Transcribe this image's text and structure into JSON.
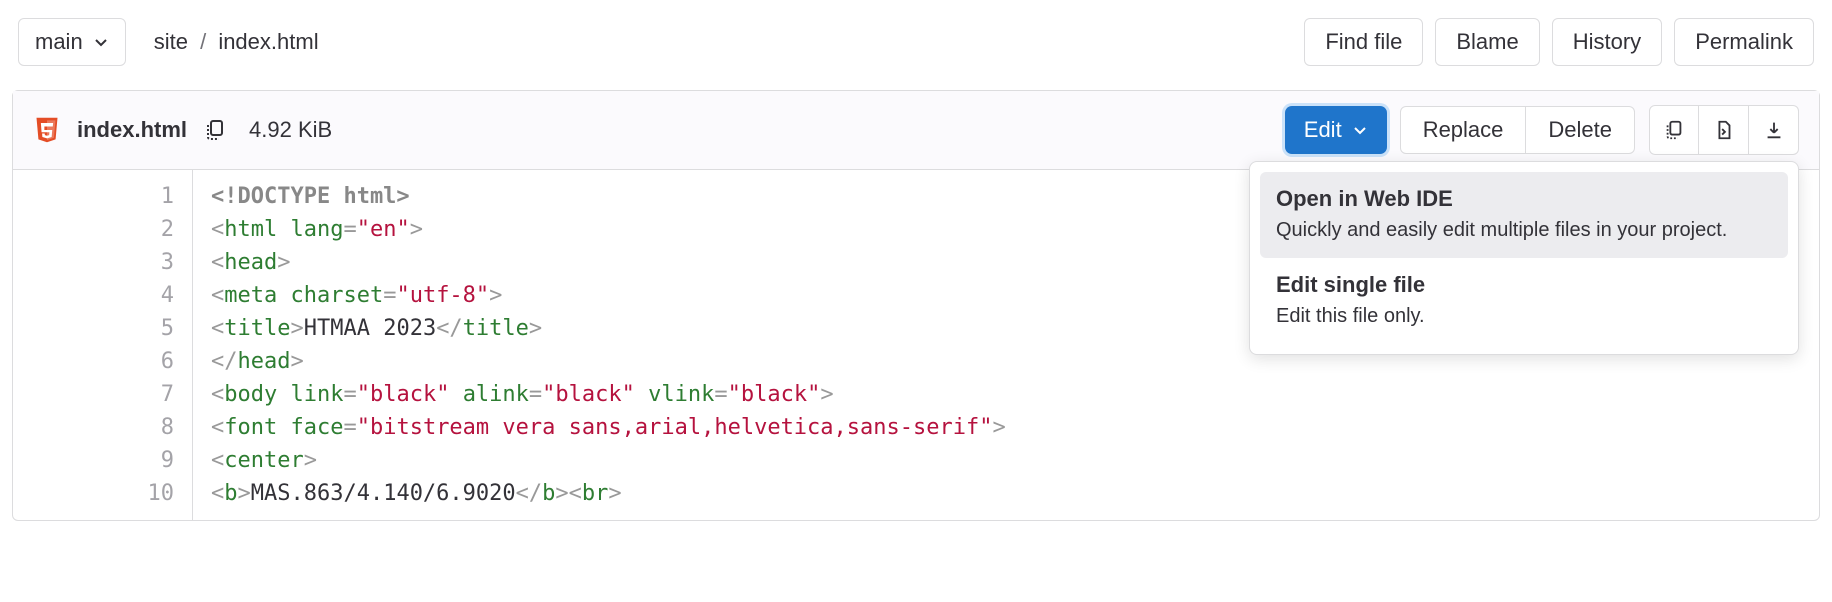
{
  "branch": {
    "label": "main"
  },
  "breadcrumb": {
    "dir": "site",
    "sep": "/",
    "file": "index.html"
  },
  "top_actions": {
    "find": "Find file",
    "blame": "Blame",
    "history": "History",
    "permalink": "Permalink"
  },
  "file": {
    "name": "index.html",
    "size": "4.92 KiB"
  },
  "header_actions": {
    "edit": "Edit",
    "replace": "Replace",
    "delete": "Delete"
  },
  "dropdown": {
    "items": [
      {
        "title": "Open in Web IDE",
        "desc": "Quickly and easily edit multiple files in your project.",
        "active": true
      },
      {
        "title": "Edit single file",
        "desc": "Edit this file only.",
        "active": false
      }
    ]
  },
  "code": {
    "lines": [
      {
        "n": 1,
        "tokens": [
          [
            "d",
            "<!DOCTYPE html>"
          ]
        ]
      },
      {
        "n": 2,
        "tokens": [
          [
            "p",
            "<"
          ],
          [
            "t",
            "html"
          ],
          [
            "tx",
            " "
          ],
          [
            "a",
            "lang"
          ],
          [
            "p",
            "="
          ],
          [
            "s",
            "\"en\""
          ],
          [
            "p",
            ">"
          ]
        ]
      },
      {
        "n": 3,
        "tokens": [
          [
            "p",
            "<"
          ],
          [
            "t",
            "head"
          ],
          [
            "p",
            ">"
          ]
        ]
      },
      {
        "n": 4,
        "tokens": [
          [
            "p",
            "<"
          ],
          [
            "t",
            "meta"
          ],
          [
            "tx",
            " "
          ],
          [
            "a",
            "charset"
          ],
          [
            "p",
            "="
          ],
          [
            "s",
            "\"utf-8\""
          ],
          [
            "p",
            ">"
          ]
        ]
      },
      {
        "n": 5,
        "tokens": [
          [
            "p",
            "<"
          ],
          [
            "t",
            "title"
          ],
          [
            "p",
            ">"
          ],
          [
            "tx",
            "HTMAA 2023"
          ],
          [
            "p",
            "</"
          ],
          [
            "t",
            "title"
          ],
          [
            "p",
            ">"
          ]
        ]
      },
      {
        "n": 6,
        "tokens": [
          [
            "p",
            "</"
          ],
          [
            "t",
            "head"
          ],
          [
            "p",
            ">"
          ]
        ]
      },
      {
        "n": 7,
        "tokens": [
          [
            "p",
            "<"
          ],
          [
            "t",
            "body"
          ],
          [
            "tx",
            " "
          ],
          [
            "a",
            "link"
          ],
          [
            "p",
            "="
          ],
          [
            "s",
            "\"black\""
          ],
          [
            "tx",
            " "
          ],
          [
            "a",
            "alink"
          ],
          [
            "p",
            "="
          ],
          [
            "s",
            "\"black\""
          ],
          [
            "tx",
            " "
          ],
          [
            "a",
            "vlink"
          ],
          [
            "p",
            "="
          ],
          [
            "s",
            "\"black\""
          ],
          [
            "p",
            ">"
          ]
        ]
      },
      {
        "n": 8,
        "tokens": [
          [
            "p",
            "<"
          ],
          [
            "t",
            "font"
          ],
          [
            "tx",
            " "
          ],
          [
            "a",
            "face"
          ],
          [
            "p",
            "="
          ],
          [
            "s",
            "\"bitstream vera sans,arial,helvetica,sans-serif\""
          ],
          [
            "p",
            ">"
          ]
        ]
      },
      {
        "n": 9,
        "tokens": [
          [
            "p",
            "<"
          ],
          [
            "t",
            "center"
          ],
          [
            "p",
            ">"
          ]
        ]
      },
      {
        "n": 10,
        "tokens": [
          [
            "p",
            "<"
          ],
          [
            "t",
            "b"
          ],
          [
            "p",
            ">"
          ],
          [
            "tx",
            "MAS.863/4.140/6.9020"
          ],
          [
            "p",
            "</"
          ],
          [
            "t",
            "b"
          ],
          [
            "p",
            "><"
          ],
          [
            "t",
            "br"
          ],
          [
            "p",
            ">"
          ]
        ]
      }
    ]
  }
}
